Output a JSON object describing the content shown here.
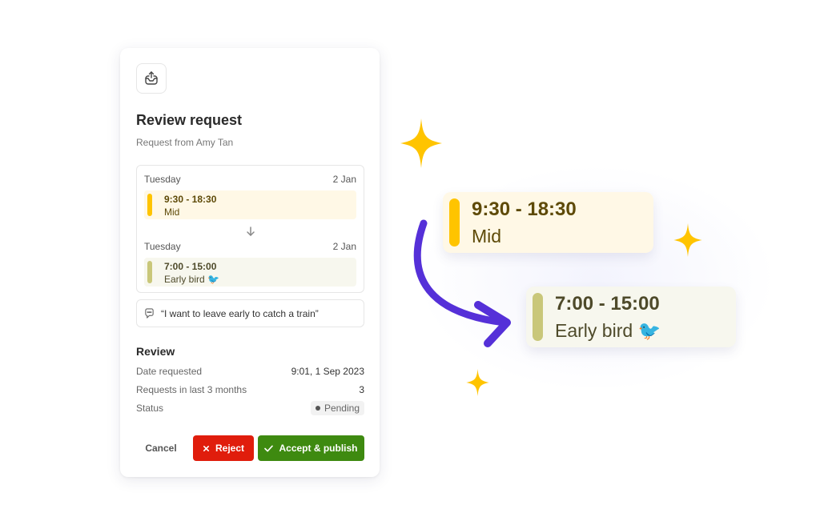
{
  "dialog": {
    "icon": "inbox-upload-icon",
    "title": "Review request",
    "subtitle": "Request from Amy Tan",
    "original_shift": {
      "day": "Tuesday",
      "date": "2 Jan",
      "time": "9:30 - 18:30",
      "name": "Mid",
      "bar_color": "#ffc400",
      "bg_color": "#fff8e6",
      "text_color": "#5e4a08"
    },
    "requested_shift": {
      "day": "Tuesday",
      "date": "2 Jan",
      "time": "7:00 - 15:00",
      "name": "Early bird 🐦",
      "bar_color": "#c9c77a",
      "bg_color": "#f7f7ee",
      "text_color": "#4e4a2a"
    },
    "comment": "“I want to leave early to catch a train”",
    "review": {
      "heading": "Review",
      "rows": [
        {
          "label": "Date requested",
          "value": "9:01, 1 Sep 2023"
        },
        {
          "label": "Requests in last 3 months",
          "value": "3"
        },
        {
          "label": "Status",
          "value": "Pending"
        }
      ]
    },
    "buttons": {
      "cancel": "Cancel",
      "reject": "Reject",
      "accept": "Accept & publish"
    }
  },
  "illustration": {
    "from_shift": {
      "time": "9:30 - 18:30",
      "name": "Mid"
    },
    "to_shift": {
      "time": "7:00 - 15:00",
      "name": "Early bird 🐦"
    },
    "arrow_color": "#5530d8",
    "sparkle_color": "#ffc400"
  }
}
